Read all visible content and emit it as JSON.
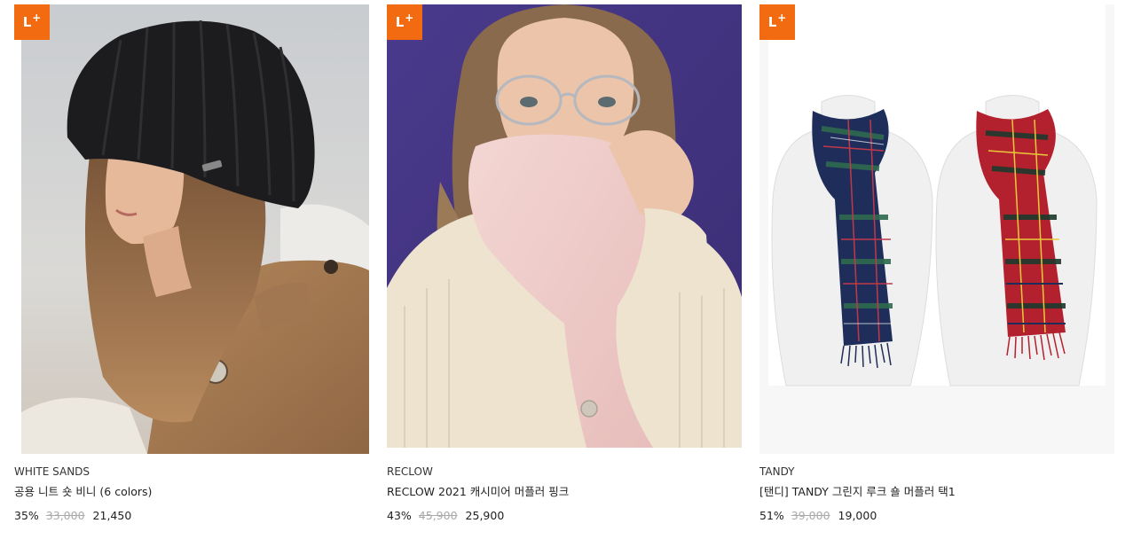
{
  "badge": {
    "label": "L",
    "plus": "+"
  },
  "products": [
    {
      "brand": "WHITE SANDS",
      "title": "공용 니트 숏 비니 (6 colors)",
      "discount": "35%",
      "original_price": "33,000",
      "sale_price": "21,450",
      "image": "woman-in-black-knit-bucket-beanie-and-trench-coat"
    },
    {
      "brand": "RECLOW",
      "title": "RECLOW 2021 캐시미어 머플러 핑크",
      "discount": "43%",
      "original_price": "45,900",
      "sale_price": "25,900",
      "image": "woman-with-glasses-in-pink-cashmere-muffler"
    },
    {
      "brand": "TANDY",
      "title": "[탠디] TANDY 그린지 루크 숄 머플러 택1",
      "discount": "51%",
      "original_price": "39,000",
      "sale_price": "19,000",
      "image": "two-tartan-plaid-scarves-on-mannequins"
    }
  ],
  "colors": {
    "badge": "#f26b11",
    "strike_price": "#aaaaaa",
    "text": "#222222"
  }
}
